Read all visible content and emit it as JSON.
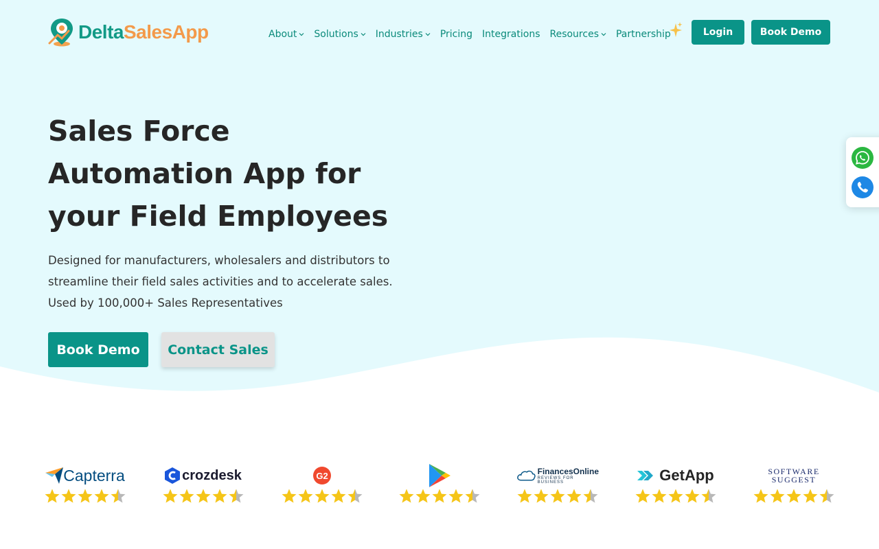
{
  "brand": {
    "logo_part1": "Delta",
    "logo_part2": "SalesApp",
    "primary_color": "#0a9488",
    "accent_color": "#f39a4a",
    "hero_bg_color": "#e4fafd"
  },
  "nav": {
    "items": [
      {
        "label": "About",
        "has_dropdown": true
      },
      {
        "label": "Solutions",
        "has_dropdown": true
      },
      {
        "label": "Industries",
        "has_dropdown": true
      },
      {
        "label": "Pricing",
        "has_dropdown": false
      },
      {
        "label": "Integrations",
        "has_dropdown": false
      },
      {
        "label": "Resources",
        "has_dropdown": true
      },
      {
        "label": "Partnership",
        "has_dropdown": false
      }
    ],
    "login_label": "Login",
    "book_demo_label": "Book Demo"
  },
  "hero": {
    "title": "Sales Force Automation App for your Field Employees",
    "subtitle_lines": [
      "Designed for manufacturers, wholesalers and distributors to",
      "streamline their field sales activities and to accelerate sales.",
      "Used by 100,000+ Sales Representatives"
    ],
    "primary_cta": "Book Demo",
    "secondary_cta": "Contact Sales"
  },
  "floating_contact": {
    "items": [
      {
        "icon": "whatsapp-icon",
        "color": "#2bb741"
      },
      {
        "icon": "phone-icon",
        "color": "#1e88e5"
      }
    ]
  },
  "reviews": [
    {
      "platform": "Capterra",
      "rating_stars": 4.5
    },
    {
      "platform": "crozdesk",
      "rating_stars": 4.5
    },
    {
      "platform": "G2",
      "rating_stars": 4.5
    },
    {
      "platform": "Google Play",
      "rating_stars": 4.5
    },
    {
      "platform": "FinancesOnline",
      "tagline": "REVIEWS FOR BUSINESS",
      "rating_stars": 4.5
    },
    {
      "platform": "GetApp",
      "rating_stars": 4.5
    },
    {
      "platform": "Software Suggest",
      "rating_stars": 4.5
    }
  ]
}
